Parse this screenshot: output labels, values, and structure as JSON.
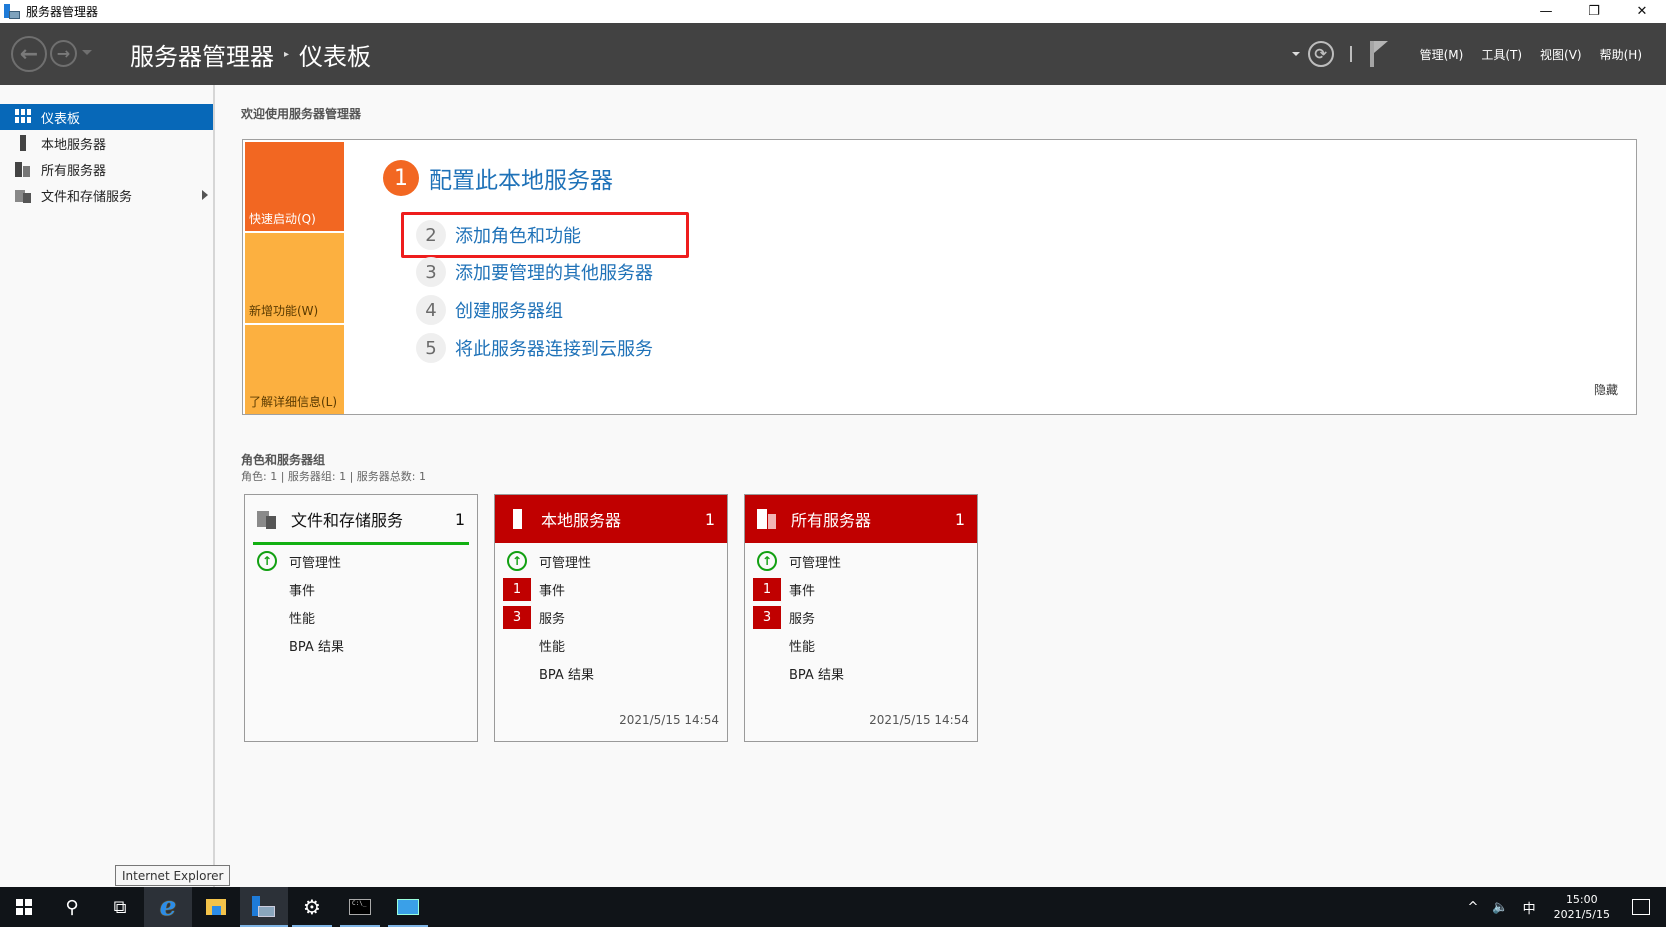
{
  "window": {
    "title": "服务器管理器",
    "controls": {
      "minimize": "—",
      "restore": "❐",
      "close": "✕"
    }
  },
  "header": {
    "breadcrumb_root": "服务器管理器",
    "breadcrumb_separator": "▸",
    "breadcrumb_current": "仪表板",
    "nav_back_icon": "←",
    "nav_forward_icon": "→",
    "refresh_icon": "⟳",
    "menus": [
      "管理(M)",
      "工具(T)",
      "视图(V)",
      "帮助(H)"
    ]
  },
  "sidebar": {
    "items": [
      {
        "label": "仪表板",
        "icon": "dashboard-icon",
        "active": true
      },
      {
        "label": "本地服务器",
        "icon": "local-server-icon",
        "active": false
      },
      {
        "label": "所有服务器",
        "icon": "all-servers-icon",
        "active": false
      },
      {
        "label": "文件和存储服务",
        "icon": "file-storage-icon",
        "active": false,
        "has_submenu": true
      }
    ]
  },
  "welcome": {
    "title": "欢迎使用服务器管理器",
    "tabs": [
      "快速启动(Q)",
      "新增功能(W)",
      "了解详细信息(L)"
    ],
    "steps": [
      {
        "num": "1",
        "label": "配置此本地服务器"
      },
      {
        "num": "2",
        "label": "添加角色和功能"
      },
      {
        "num": "3",
        "label": "添加要管理的其他服务器"
      },
      {
        "num": "4",
        "label": "创建服务器组"
      },
      {
        "num": "5",
        "label": "将此服务器连接到云服务"
      }
    ],
    "hide_label": "隐藏"
  },
  "roles": {
    "title": "角色和服务器组",
    "summary": "角色: 1 | 服务器组: 1 | 服务器总数: 1",
    "tiles": [
      {
        "name": "文件和存储服务",
        "count": "1",
        "status": "ok",
        "rows": [
          {
            "label": "可管理性",
            "badge": "up"
          },
          {
            "label": "事件",
            "badge": ""
          },
          {
            "label": "性能",
            "badge": ""
          },
          {
            "label": "BPA 结果",
            "badge": ""
          }
        ],
        "timestamp": ""
      },
      {
        "name": "本地服务器",
        "count": "1",
        "status": "alert",
        "rows": [
          {
            "label": "可管理性",
            "badge": "up"
          },
          {
            "label": "事件",
            "badge": "1"
          },
          {
            "label": "服务",
            "badge": "3"
          },
          {
            "label": "性能",
            "badge": ""
          },
          {
            "label": "BPA 结果",
            "badge": ""
          }
        ],
        "timestamp": "2021/5/15 14:54"
      },
      {
        "name": "所有服务器",
        "count": "1",
        "status": "alert",
        "rows": [
          {
            "label": "可管理性",
            "badge": "up"
          },
          {
            "label": "事件",
            "badge": "1"
          },
          {
            "label": "服务",
            "badge": "3"
          },
          {
            "label": "性能",
            "badge": ""
          },
          {
            "label": "BPA 结果",
            "badge": ""
          }
        ],
        "timestamp": "2021/5/15 14:54"
      }
    ]
  },
  "tooltip": "Internet Explorer",
  "taskbar": {
    "apps": [
      "start",
      "search",
      "task-view",
      "internet-explorer",
      "file-explorer",
      "server-manager",
      "settings",
      "command-prompt",
      "control-panel"
    ],
    "tray": {
      "chevron": "^",
      "volume": "🔈",
      "ime": "中",
      "time": "15:00",
      "date": "2021/5/15"
    }
  },
  "colors": {
    "accent_blue": "#0768b8",
    "quickstart_orange": "#f26722",
    "tab_yellow": "#fcb040",
    "alert_red": "#c00000",
    "ok_green": "#12b012",
    "link_blue": "#1f72b8",
    "highlight_red": "#ee1c1c"
  }
}
